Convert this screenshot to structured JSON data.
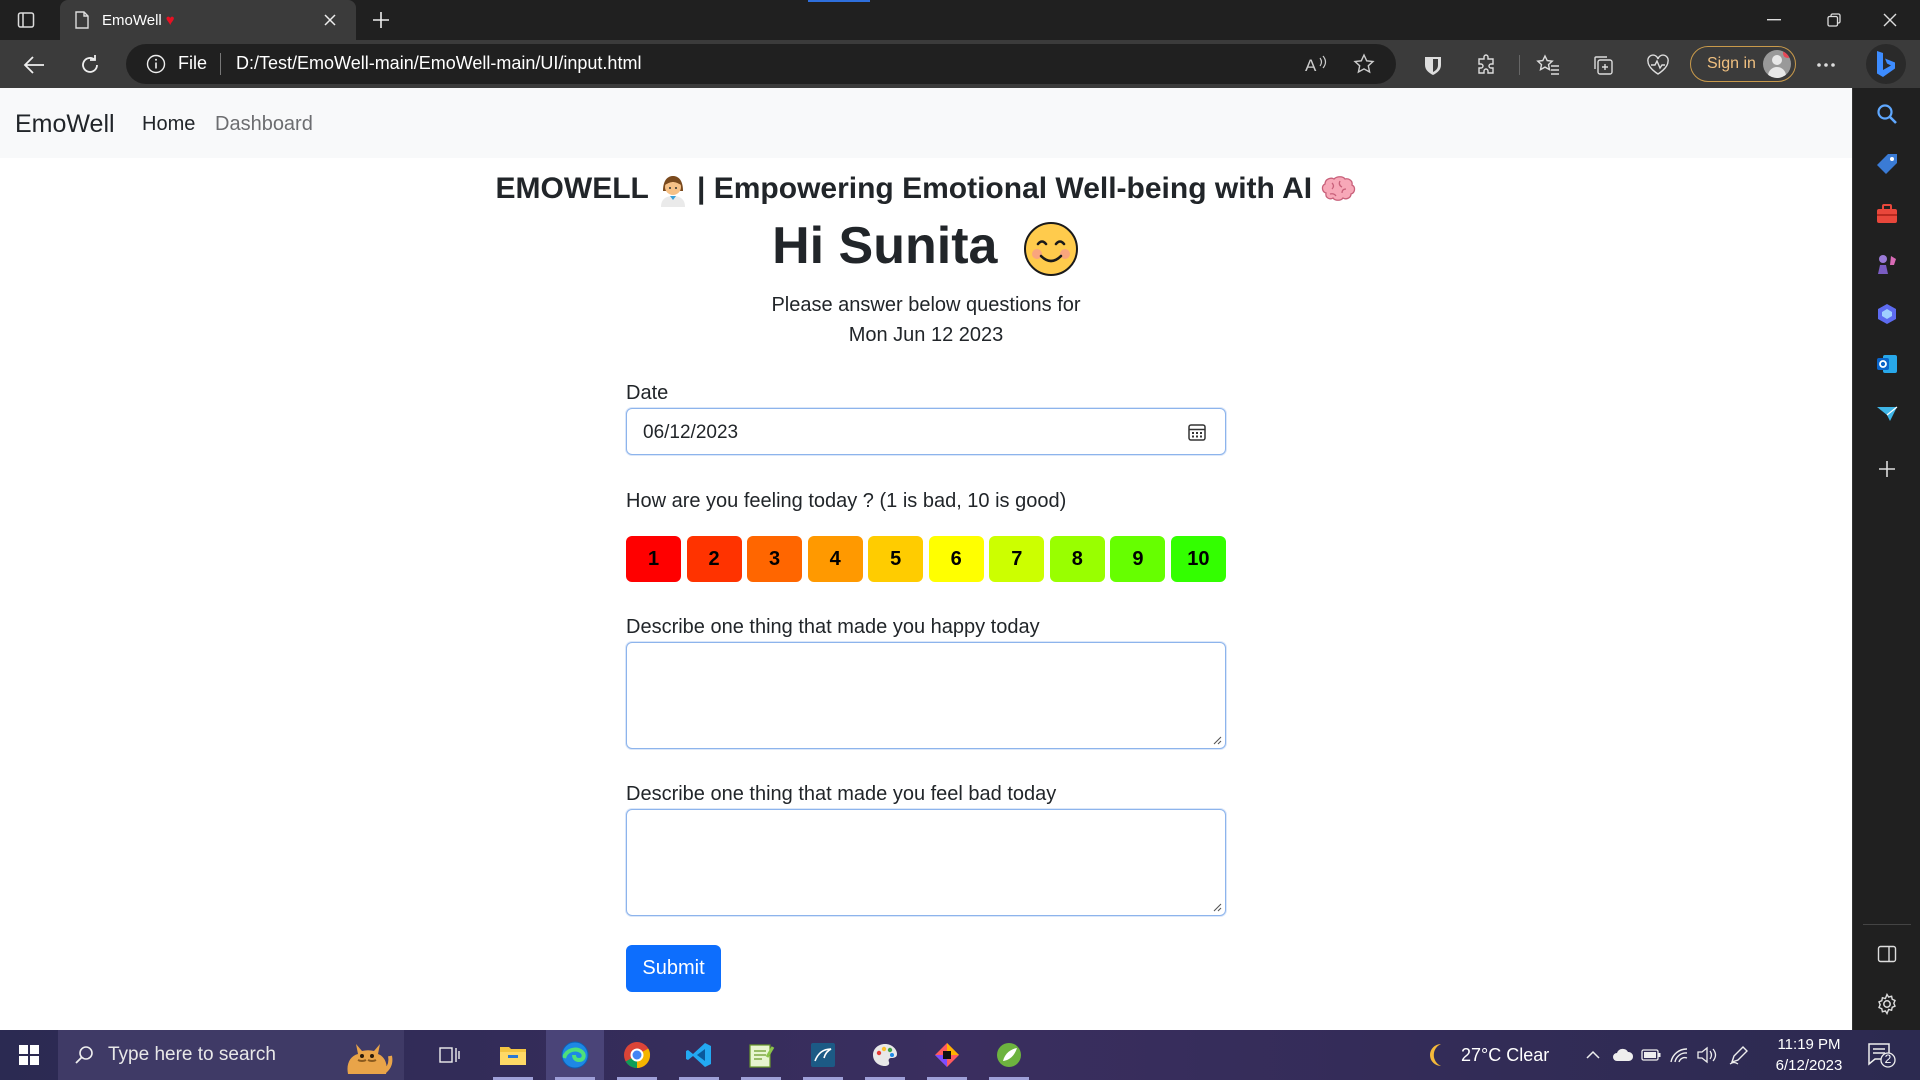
{
  "browser": {
    "tab_title": "EmoWell",
    "tab_heart": "♥",
    "url_label": "File",
    "url": "D:/Test/EmoWell-main/EmoWell-main/UI/input.html",
    "signin_label": "Sign in"
  },
  "navbar": {
    "brand": "EmoWell",
    "links": [
      "Home",
      "Dashboard"
    ]
  },
  "header": {
    "title_prefix": "EMOWELL",
    "title_suffix": "| Empowering Emotional Well-being with AI",
    "greeting": "Hi Sunita",
    "instruction_line1": "Please answer below questions for",
    "instruction_line2": "Mon Jun 12 2023"
  },
  "form": {
    "date_label": "Date",
    "date_value": "06/12/2023",
    "feeling_label": "How are you feeling today ? (1 is bad, 10 is good)",
    "ratings": [
      {
        "label": "1",
        "color": "#ff0000"
      },
      {
        "label": "2",
        "color": "#ff3300"
      },
      {
        "label": "3",
        "color": "#ff6600"
      },
      {
        "label": "4",
        "color": "#ff9900"
      },
      {
        "label": "5",
        "color": "#ffcc00"
      },
      {
        "label": "6",
        "color": "#ffff00"
      },
      {
        "label": "7",
        "color": "#ccff00"
      },
      {
        "label": "8",
        "color": "#99ff00"
      },
      {
        "label": "9",
        "color": "#66ff00"
      },
      {
        "label": "10",
        "color": "#33ff00"
      }
    ],
    "happy_label": "Describe one thing that made you happy today",
    "happy_value": "",
    "bad_label": "Describe one thing that made you feel bad today",
    "bad_value": "",
    "submit_label": "Submit"
  },
  "taskbar": {
    "search_placeholder": "Type here to search",
    "weather": "27°C  Clear",
    "time": "11:19 PM",
    "date": "6/12/2023",
    "notification_count": "2"
  },
  "colors": {
    "primary": "#0d6efd",
    "focus_border": "#8db4ec"
  }
}
